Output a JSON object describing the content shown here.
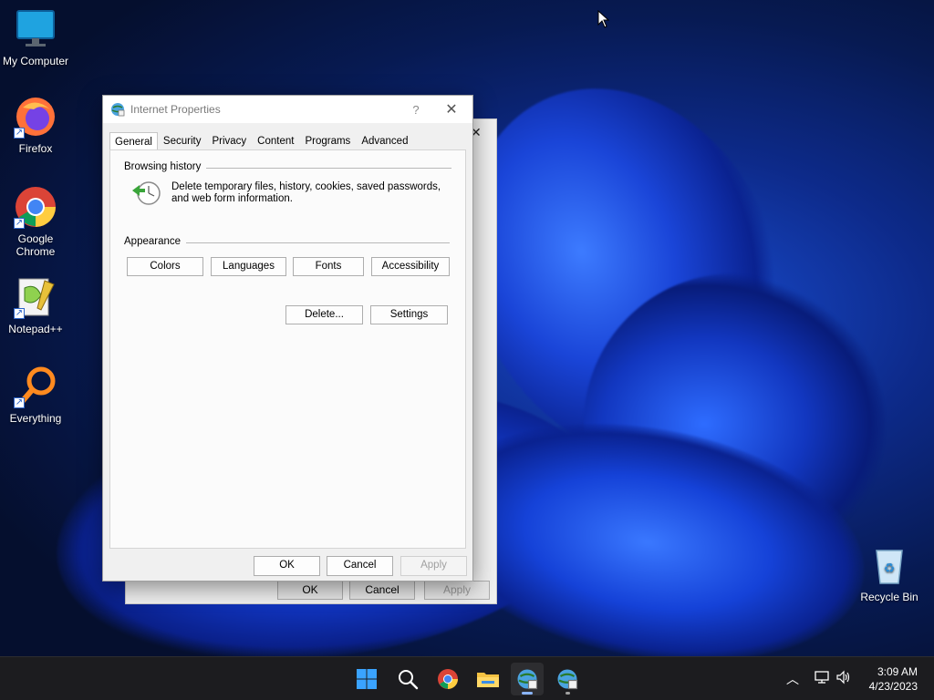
{
  "desktop": {
    "icons": [
      {
        "label": "My Computer",
        "icon": "monitor-icon"
      },
      {
        "label": "Firefox",
        "icon": "firefox-icon"
      },
      {
        "label": "Google Chrome",
        "icon": "chrome-icon"
      },
      {
        "label": "Notepad++",
        "icon": "notepadpp-icon"
      },
      {
        "label": "Everything",
        "icon": "everything-search-icon"
      },
      {
        "label": "Recycle Bin",
        "icon": "recycle-bin-icon"
      }
    ]
  },
  "back_dialog": {
    "close": "✕",
    "buttons": {
      "ok": "OK",
      "cancel": "Cancel",
      "apply": "Apply"
    }
  },
  "dialog": {
    "title": "Internet Properties",
    "help": "?",
    "close": "✕",
    "tabs": [
      "General",
      "Security",
      "Privacy",
      "Content",
      "Programs",
      "Advanced"
    ],
    "active_tab": "General",
    "browsing_history": {
      "label": "Browsing history",
      "description": "Delete temporary files, history, cookies, saved passwords, and web form information.",
      "delete_button": "Delete...",
      "settings_button": "Settings"
    },
    "appearance": {
      "label": "Appearance",
      "colors_button": "Colors",
      "languages_button": "Languages",
      "fonts_button": "Fonts",
      "accessibility_button": "Accessibility"
    },
    "footer": {
      "ok": "OK",
      "cancel": "Cancel",
      "apply": "Apply"
    }
  },
  "taskbar": {
    "items": [
      "start-icon",
      "search-icon",
      "chrome-icon",
      "file-explorer-icon",
      "internet-properties-icon",
      "internet-properties-icon"
    ],
    "clock": {
      "time": "3:09 AM",
      "date": "4/23/2023"
    },
    "tray": [
      "chevron-up-icon",
      "network-icon",
      "volume-icon"
    ],
    "accent_color": "#8ab4ff"
  }
}
